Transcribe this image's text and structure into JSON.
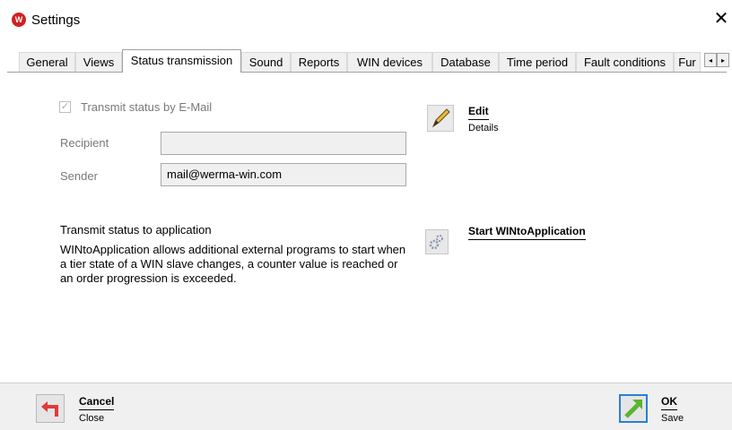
{
  "window": {
    "title": "Settings",
    "app_icon_glyph": "W",
    "close_glyph": "✕"
  },
  "tabs": [
    {
      "label": "General"
    },
    {
      "label": "Views"
    },
    {
      "label": "Status transmission",
      "active": true
    },
    {
      "label": "Sound"
    },
    {
      "label": "Reports"
    },
    {
      "label": "WIN devices"
    },
    {
      "label": "Database"
    },
    {
      "label": "Time period"
    },
    {
      "label": "Fault conditions"
    },
    {
      "label": "Fur"
    }
  ],
  "tab_scroll": {
    "left": "◂",
    "right": "▸"
  },
  "email": {
    "checkbox_label": "Transmit status by E-Mail",
    "checkbox_checked": true,
    "recipient_label": "Recipient",
    "recipient_value": "",
    "sender_label": "Sender",
    "sender_value": "mail@werma-win.com"
  },
  "edit_action": {
    "title": "Edit",
    "subtitle": "Details",
    "icon": "pencil-icon"
  },
  "application": {
    "section_title": "Transmit status to application",
    "description": "WINtoApplication allows additional external programs to start when a tier state of a WIN slave changes, a counter value is reached or an order progression is exceeded.",
    "action_title": "Start WINtoApplication",
    "icon": "gears-icon"
  },
  "footer": {
    "cancel_title": "Cancel",
    "cancel_subtitle": "Close",
    "ok_title": "OK",
    "ok_subtitle": "Save"
  },
  "colors": {
    "brand_red": "#d32020",
    "ok_border": "#2a7fd4",
    "ok_arrow": "#5ab52e",
    "cancel_arrow": "#e03a3a"
  }
}
